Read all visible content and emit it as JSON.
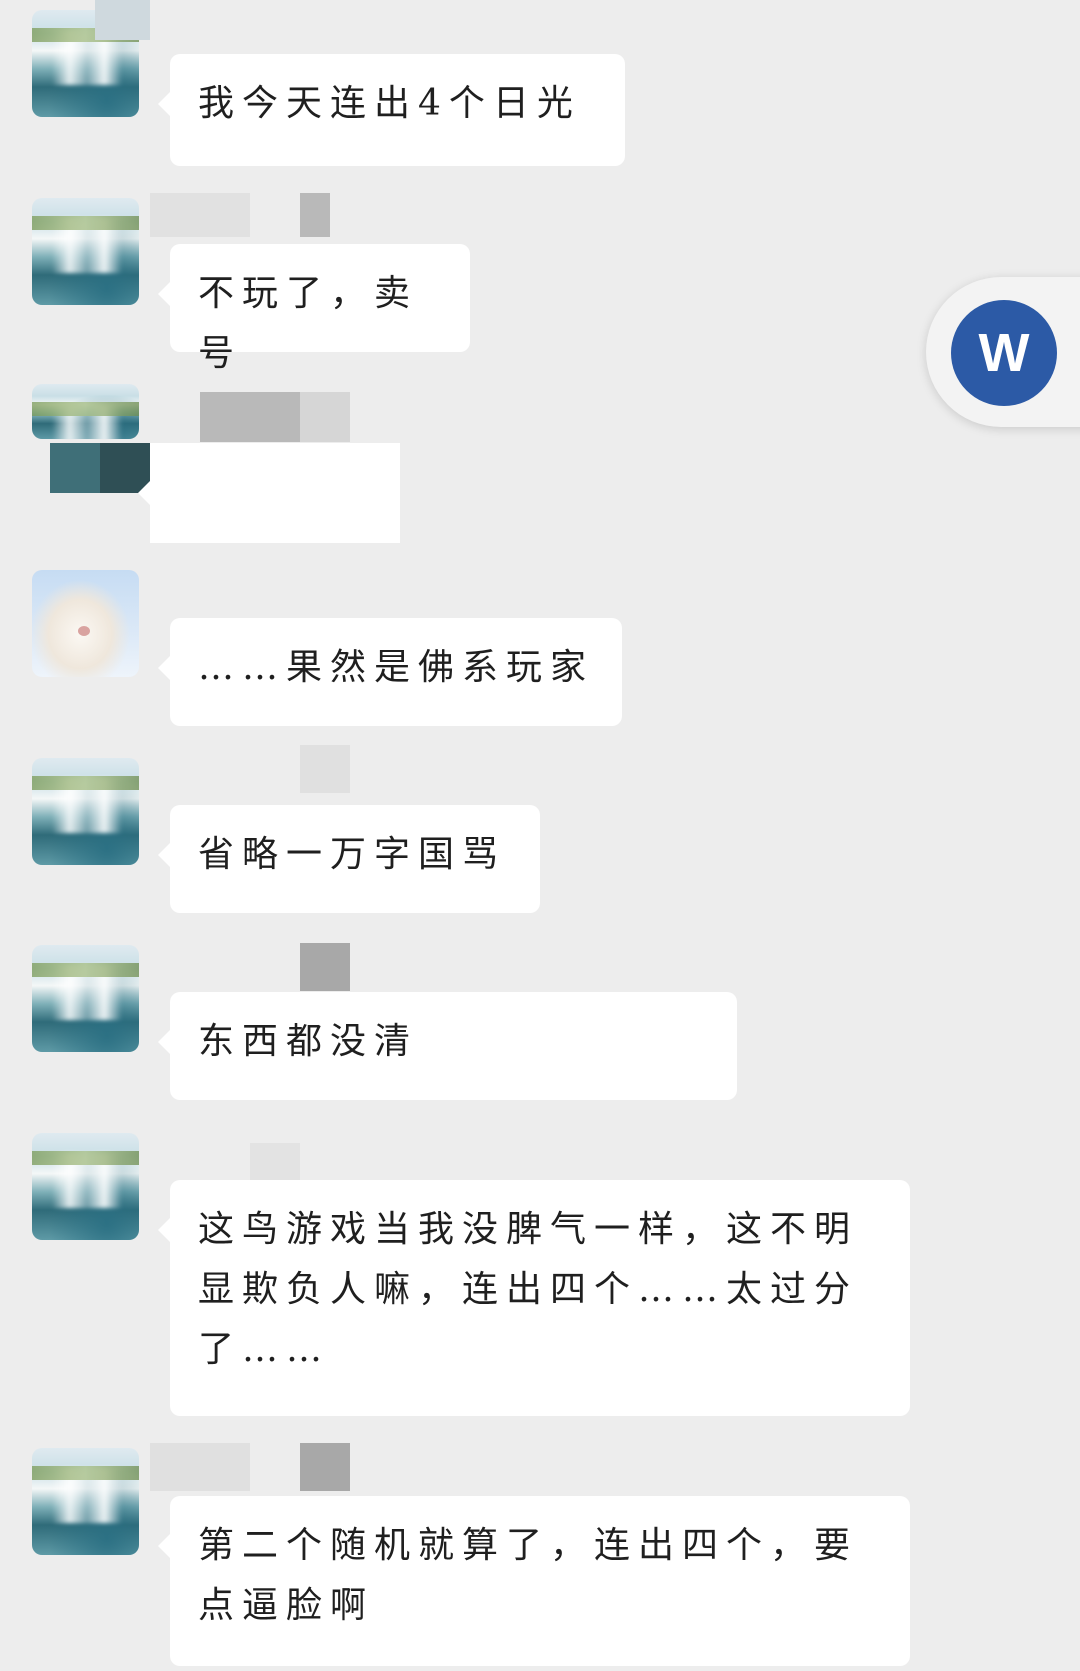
{
  "messages": [
    {
      "id": 1,
      "avatar": "waterfall",
      "text": "我今天连出4个日光"
    },
    {
      "id": 2,
      "avatar": "waterfall",
      "text": "不玩了，卖号"
    },
    {
      "id": 3,
      "avatar": "waterfall",
      "text": ""
    },
    {
      "id": 4,
      "avatar": "sheep",
      "text": "……果然是佛系玩家"
    },
    {
      "id": 5,
      "avatar": "waterfall",
      "text": "省略一万字国骂"
    },
    {
      "id": 6,
      "avatar": "waterfall",
      "text": "东西都没清"
    },
    {
      "id": 7,
      "avatar": "waterfall",
      "text": "这鸟游戏当我没脾气一样，这不明显欺负人嘛，连出四个……太过分了……"
    },
    {
      "id": 8,
      "avatar": "waterfall",
      "text": "第二个随机就算了，连出四个，要点逼脸啊"
    }
  ],
  "floating_button": {
    "label": "W",
    "color": "#2c5aa6"
  }
}
